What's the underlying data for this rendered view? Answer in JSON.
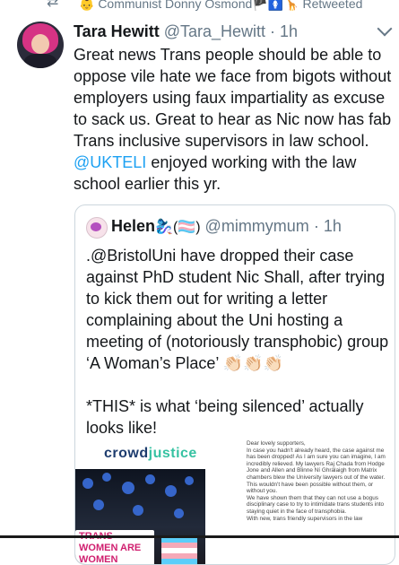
{
  "retweet": {
    "icon": "retweet-icon",
    "text": "👶 Communist Donny Osmond🏴🚺🦒 Retweeted"
  },
  "tweet": {
    "author_name": "Tara Hewitt",
    "author_handle": "@Tara_Hewitt",
    "separator": "·",
    "time": "1h",
    "text_before_mention": "Great news Trans people should be able to oppose vile hate we face from bigots without employers using faux impartiality as excuse to sack us. Great to hear as Nic now has fab Trans inclusive supervisors in law school.",
    "mention": "@UKTELI",
    "text_after_mention": "enjoyed working with the law school earlier this yr."
  },
  "quoted_tweet": {
    "author_name": "Helen",
    "author_emoji": "🧞‍♀️(🏳️‍⚧️)",
    "author_handle": "@mimmymum",
    "separator": "·",
    "time": "1h",
    "text": ".@BristolUni have dropped their case against PhD student Nic Shall, after trying to kick them out for writing a letter complaining about the Uni hosting a meeting of (notoriously transphobic) group ‘A Woman’s Place’ 👏🏻👏🏻👏🏻\n\n*THIS* is what ‘being silenced’ actually looks like!",
    "media": {
      "logo_part1": "crowd",
      "logo_part2": "justice",
      "sign_text": "TRANS WOMEN ARE WOMEN",
      "letter_text": "Dear lovely supporters,\nIn case you hadn't already heard, the case against me has been dropped! As I am sure you can imagine, I am incredibly relieved. My lawyers Raj Chada from Hodge Jone and Allen and Blinne Ní Ghrálaigh from Matrix chambers blew the University lawyers out of the water. This wouldn't have been possible without them, or without you.\nWe have shown them that they can not use a bogus disciplinary case to try to intimidate trans students into staying quiet in the face of transphobia.\nWith new, trans friendly supervisors in the law"
    }
  },
  "colors": {
    "link": "#1da1f2",
    "secondary_text": "#657786",
    "border": "#ccd6dd",
    "logo_dark": "#1d3c6e",
    "logo_teal": "#36c2a2"
  }
}
